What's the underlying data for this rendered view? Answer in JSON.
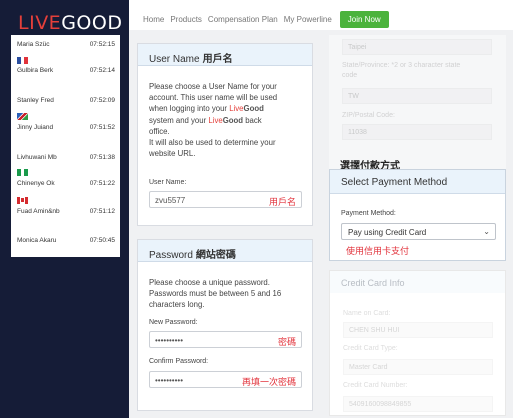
{
  "brand": {
    "live": "LIVE",
    "good": "GOOD"
  },
  "feed": [
    {
      "name": "Maria Szüc",
      "time": "07:52:15",
      "flag": null
    },
    {
      "name": "Gulbira Berk",
      "time": "07:52:14",
      "flag": "fr"
    },
    {
      "name": "Stanley Fred",
      "time": "07:52:09",
      "flag": null
    },
    {
      "name": "Jinny Juiand",
      "time": "07:51:52",
      "flag": "na"
    },
    {
      "name": "Livhuwani Mb",
      "time": "07:51:38",
      "flag": null
    },
    {
      "name": "Chinenye Ok",
      "time": "07:51:22",
      "flag": "ng"
    },
    {
      "name": "Fuad Amin&nb",
      "time": "07:51:12",
      "flag": "ca"
    },
    {
      "name": "Monica Akaru",
      "time": "07:50:45",
      "flag": null
    }
  ],
  "nav": {
    "home": "Home",
    "products": "Products",
    "compensation": "Compensation Plan",
    "powerline": "My Powerline",
    "join": "Join Now"
  },
  "username_card": {
    "title": "User Name",
    "title_zh": "用戶名",
    "desc_1": "Please choose a User Name for your",
    "desc_2": "account. This user name will be used",
    "desc_3a": "when logging into your",
    "desc_3_live": "Live",
    "desc_3_good": "Good",
    "desc_4a": "system and your",
    "desc_4_live": "Live",
    "desc_4_good": "Good",
    "desc_4b": "back",
    "desc_5": "office.",
    "desc_6": "It will also be used to determine your",
    "desc_7": "website URL.",
    "field_label": "User Name:",
    "field_value": "zvu5577",
    "annotation": "用戶名"
  },
  "password_card": {
    "title": "Password",
    "title_zh": "網站密碼",
    "desc_1": "Please choose a unique password.",
    "desc_2": "Passwords must be between 5 and 16",
    "desc_3": "characters long.",
    "new_label": "New Password:",
    "new_value": "••••••••••",
    "new_annotation": "密碼",
    "confirm_label": "Confirm Password:",
    "confirm_value": "••••••••••",
    "confirm_annotation": "再填一次密碼"
  },
  "address_faded": {
    "value_top": "Taipei",
    "state_label_1": "State/Province: *2 or 3 character state",
    "state_label_2": "code",
    "state_value": "TW",
    "zip_label": "ZIP/Postal Code:",
    "zip_value": "11038"
  },
  "payment_card": {
    "zh_caption": "選擇付款方式",
    "title": "Select Payment Method",
    "field_label": "Payment Method:",
    "selected": "Pay using Credit Card",
    "annotation": "使用信用卡支付"
  },
  "credit_card_faded": {
    "title": "Credit Card Info",
    "name_label": "Name on Card:",
    "name_value": "CHEN SHU HUI",
    "type_label": "Credit Card Type:",
    "type_value": "Master Card",
    "number_label": "Credit Card Number:",
    "number_value": "5409160098849855"
  }
}
